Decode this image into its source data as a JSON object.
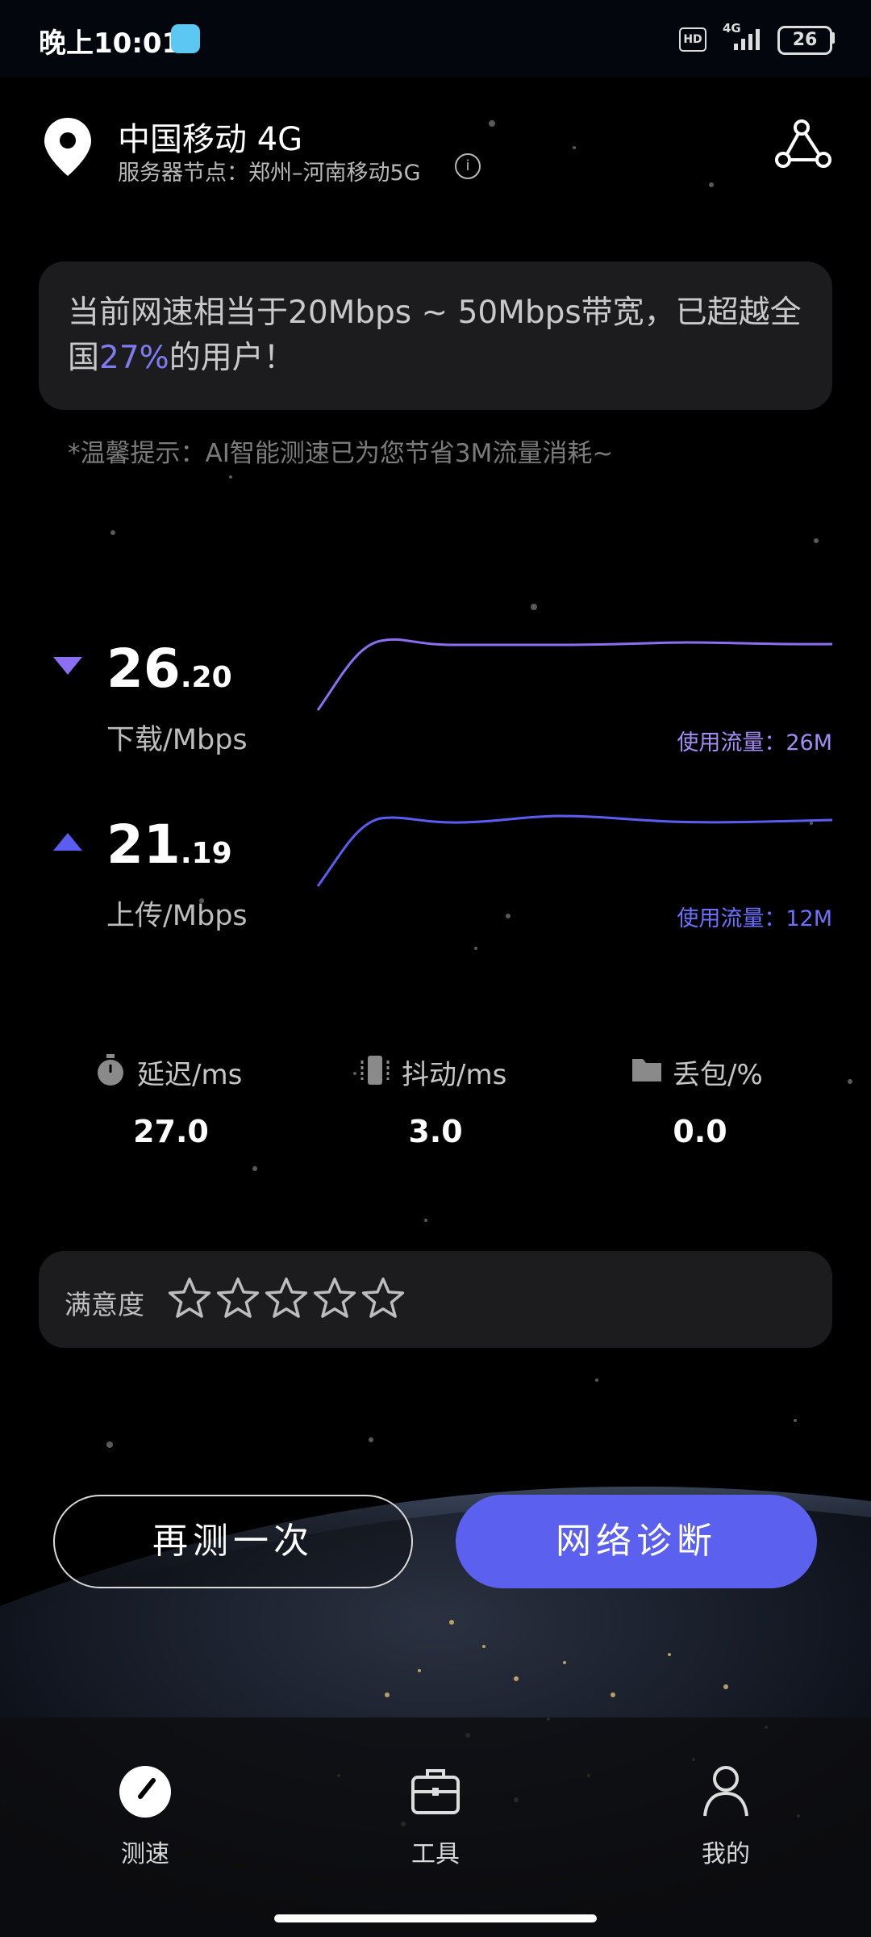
{
  "status_bar": {
    "time": "晚上10:01",
    "hd": "HD",
    "network": "4G",
    "battery": "26"
  },
  "header": {
    "carrier": "中国移动 4G",
    "server": "服务器节点：郑州–河南移动5G",
    "info_icon": "info-icon",
    "share_icon": "share-nodes-icon"
  },
  "summary": {
    "prefix": "当前网速相当于20Mbps ~ 50Mbps带宽，已超越全国",
    "percent": "27%",
    "suffix": "的用户！"
  },
  "tip": "*温馨提示：AI智能测速已为您节省3M流量消耗~",
  "download": {
    "integer": "26",
    "decimal": ".20",
    "unit": "下载/Mbps",
    "usage": "使用流量：26M",
    "color": "#8b6ff0"
  },
  "upload": {
    "integer": "21",
    "decimal": ".19",
    "unit": "上传/Mbps",
    "usage": "使用流量：12M",
    "color": "#5b5cf0"
  },
  "metrics": [
    {
      "label": "延迟/ms",
      "value": "27.0",
      "icon": "stopwatch-icon"
    },
    {
      "label": "抖动/ms",
      "value": "3.0",
      "icon": "vibration-icon"
    },
    {
      "label": "丢包/%",
      "value": "0.0",
      "icon": "folder-icon"
    }
  ],
  "rating": {
    "label": "满意度",
    "stars_total": 5,
    "stars_filled": 0
  },
  "buttons": {
    "retest": "再测一次",
    "diagnose": "网络诊断"
  },
  "nav": [
    {
      "label": "测速",
      "icon": "speedometer-icon",
      "active": true
    },
    {
      "label": "工具",
      "icon": "toolbox-icon",
      "active": false
    },
    {
      "label": "我的",
      "icon": "user-icon",
      "active": false
    }
  ],
  "colors": {
    "accent": "#5b60ee",
    "highlight": "#7f7cf2",
    "card": "#1c1c1e"
  }
}
